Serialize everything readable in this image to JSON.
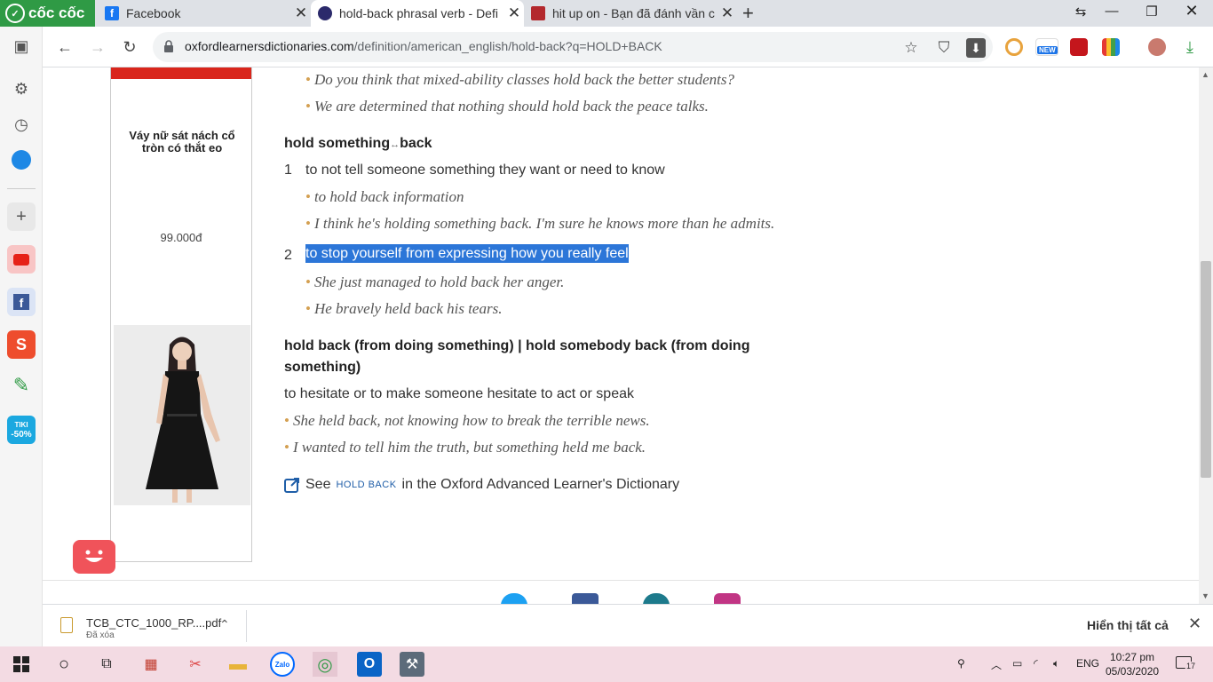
{
  "browser": {
    "brand": "cốc cốc",
    "tabs": [
      {
        "title": "Facebook",
        "color": "#1877f2"
      },
      {
        "title": "hold-back phrasal verb - Defi",
        "color": "#2b2a6b"
      },
      {
        "title": "hit up on - Bạn đã đánh vần c",
        "color": "#b3282d"
      }
    ],
    "url_host": "oxfordlearnersdictionaries.com",
    "url_path": "/definition/american_english/hold-back?q=HOLD+BACK",
    "ext_new_badge": "NEW"
  },
  "sidebar": {
    "tiki_label": "TIKI",
    "tiki_discount": "-50%"
  },
  "ad": {
    "title": "Váy nữ sát nách cổ tròn có thắt eo",
    "price": "99.000đ"
  },
  "dictionary": {
    "examples_top": [
      "Do you think that mixed-ability classes hold back the better students?",
      "We are determined that nothing should hold back the peace talks."
    ],
    "phrase2": {
      "head_a": "hold something",
      "arrow": "↔",
      "head_b": "back",
      "senses": [
        {
          "num": "1",
          "def": "to not tell someone something they want or need to know",
          "examples": [
            "to hold back information",
            "I think he's holding something back. I'm sure he knows more than he admits."
          ]
        },
        {
          "num": "2",
          "def": "to stop yourself from expressing how you really feel",
          "examples": [
            "She just managed to hold back her anger.",
            "He bravely held back his tears."
          ]
        }
      ]
    },
    "phrase3": {
      "head_line1": "hold back (from doing something) | hold somebody back (from doing",
      "head_line2": "something)",
      "def": "to hesitate or to make someone hesitate to act or speak",
      "examples": [
        "She held back, not knowing how to break the terrible news.",
        "I wanted to tell him the truth, but something held me back."
      ]
    },
    "see_also": {
      "prefix": "See",
      "link": "HOLD BACK",
      "suffix": "in the Oxford Advanced Learner's Dictionary"
    }
  },
  "downloads": {
    "file_name": "TCB_CTC_1000_RP....pdf",
    "file_status": "Đã xóa",
    "show_all": "Hiển thị tất cả"
  },
  "taskbar": {
    "zalo": "Zalo",
    "language": "ENG",
    "time": "10:27 pm",
    "date": "05/03/2020",
    "notification_count": "17"
  }
}
